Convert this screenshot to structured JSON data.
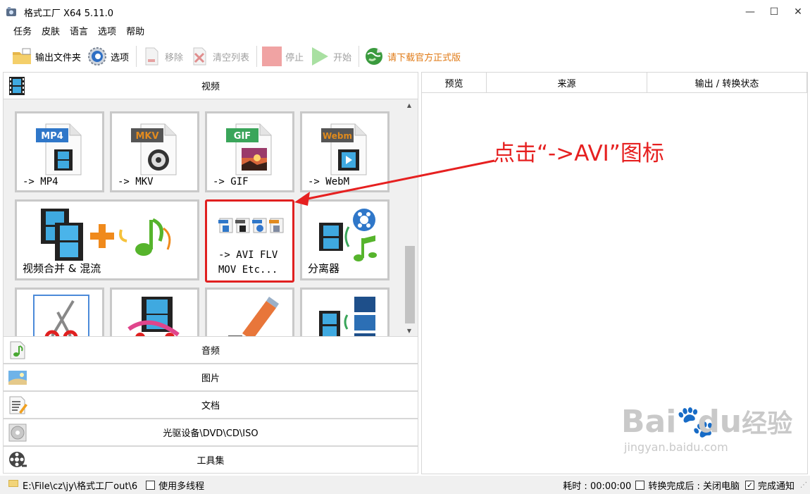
{
  "window": {
    "title": "格式工厂 X64 5.11.0",
    "minimize": "—",
    "maximize": "☐",
    "close": "✕"
  },
  "menu": [
    "任务",
    "皮肤",
    "语言",
    "选项",
    "帮助"
  ],
  "toolbar": {
    "output_folder": "输出文件夹",
    "options": "选项",
    "remove": "移除",
    "clear_list": "清空列表",
    "stop": "停止",
    "start": "开始",
    "download_official": "请下载官方正式版"
  },
  "categories": {
    "video": "视频",
    "audio": "音频",
    "picture": "图片",
    "document": "文档",
    "disc": "光驱设备\\DVD\\CD\\ISO",
    "tools": "工具集"
  },
  "video_tiles": {
    "mp4": {
      "badge": "MP4",
      "label": "-> MP4",
      "badge_color": "#2f77c9"
    },
    "mkv": {
      "badge": "MKV",
      "label": "-> MKV",
      "badge_color": "#e28b1f"
    },
    "gif": {
      "badge": "GIF",
      "label": "-> GIF",
      "badge_color": "#3aa55a"
    },
    "webm": {
      "badge": "Webm",
      "label": "-> WebM",
      "badge_color": "#e08a1c"
    },
    "merge": {
      "label": "视频合并 & 混流"
    },
    "avi": {
      "label_line1": "-> AVI FLV",
      "label_line2": "MOV Etc..."
    },
    "splitter": {
      "label": "分离器"
    }
  },
  "grid_headers": [
    "预览",
    "来源",
    "输出 / 转换状态"
  ],
  "annotation": "点击“->AVI”图标",
  "status": {
    "output_path": "E:\\File\\cz\\jy\\格式工厂out\\6",
    "multithread": "使用多线程",
    "elapsed_label": "耗时 : 00:00:00",
    "after_convert": "转换完成后 : 关闭电脑",
    "notify": "完成通知",
    "notify_check": "✓"
  },
  "watermark": {
    "brand": "Bai",
    "brand2": "du",
    "suffix": "经验",
    "url": "jingyan.baidu.com"
  },
  "colors": {
    "highlight_red": "#e02020",
    "annotation_red": "#e62020",
    "promo_orange": "#e07a16"
  }
}
